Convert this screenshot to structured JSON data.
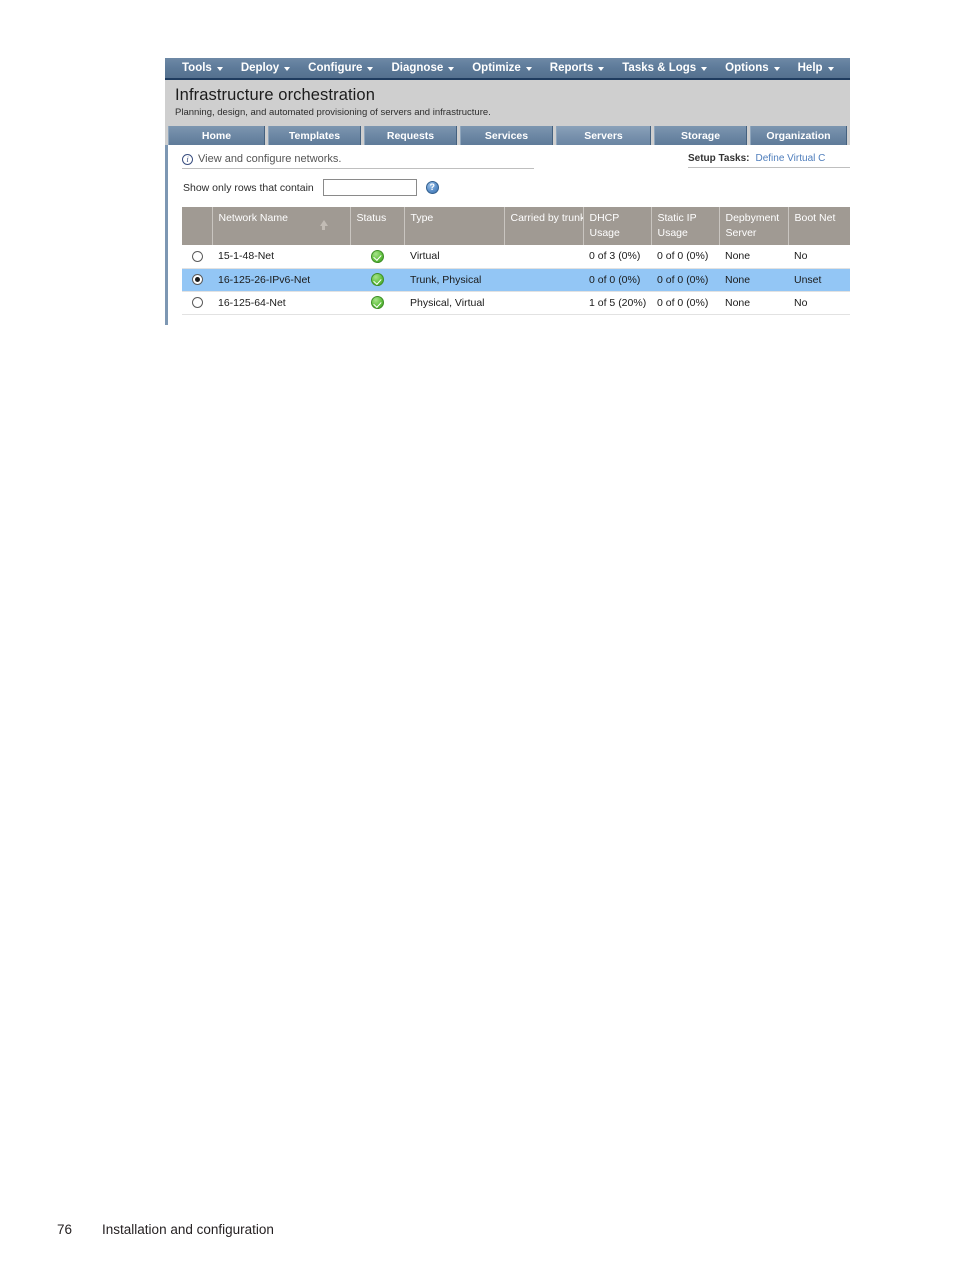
{
  "menu_bar": {
    "items": [
      {
        "label": "Tools",
        "has_caret": true
      },
      {
        "label": "Deploy",
        "has_caret": true
      },
      {
        "label": "Configure",
        "has_caret": true
      },
      {
        "label": "Diagnose",
        "has_caret": true
      },
      {
        "label": "Optimize",
        "has_caret": true
      },
      {
        "label": "Reports",
        "has_caret": true
      },
      {
        "label": "Tasks & Logs",
        "has_caret": true
      },
      {
        "label": "Options",
        "has_caret": true
      },
      {
        "label": "Help",
        "has_caret": true
      }
    ]
  },
  "header": {
    "title": "Infrastructure orchestration",
    "subtitle": "Planning, design, and automated provisioning of servers and infrastructure."
  },
  "tabs": [
    {
      "label": "Home",
      "active": false
    },
    {
      "label": "Templates",
      "active": false
    },
    {
      "label": "Requests",
      "active": false
    },
    {
      "label": "Services",
      "active": false
    },
    {
      "label": "Servers",
      "active": true
    },
    {
      "label": "Storage",
      "active": false
    },
    {
      "label": "Organization",
      "active": false
    }
  ],
  "info_bar": {
    "icon": "info-icon",
    "text": "View and configure networks."
  },
  "setup_tasks": {
    "label": "Setup Tasks:",
    "link_text": "Define Virtual C",
    "link_color": "#4f7ebc"
  },
  "filter": {
    "label": "Show only rows that contain",
    "value": "",
    "placeholder": "",
    "help_icon": "help-icon"
  },
  "table": {
    "sort_column": "Network Name",
    "sort_direction": "ascending",
    "columns": [
      {
        "key": "select",
        "label": ""
      },
      {
        "key": "name",
        "label": "Network Name"
      },
      {
        "key": "status",
        "label": "Status"
      },
      {
        "key": "type",
        "label": "Type"
      },
      {
        "key": "trunk",
        "label": "Carried by trunk"
      },
      {
        "key": "dhcp",
        "label": "DHCP",
        "sub": "Usage"
      },
      {
        "key": "static",
        "label": "Static IP",
        "sub": "Usage"
      },
      {
        "key": "deploy",
        "label": "Depbyment",
        "sub": "Server"
      },
      {
        "key": "boot",
        "label": "Boot Net"
      }
    ],
    "rows": [
      {
        "selected": false,
        "name": "15-1-48-Net",
        "status": "ok",
        "type": "Virtual",
        "trunk": "",
        "dhcp": "0 of 3 (0%)",
        "static": "0 of 0 (0%)",
        "deploy": "None",
        "boot": "No"
      },
      {
        "selected": true,
        "name": "16-125-26-IPv6-Net",
        "status": "ok",
        "type": "Trunk, Physical",
        "trunk": "",
        "dhcp": "0 of 0 (0%)",
        "static": "0 of 0 (0%)",
        "deploy": "None",
        "boot": "Unset"
      },
      {
        "selected": false,
        "name": "16-125-64-Net",
        "status": "ok",
        "type": "Physical, Virtual",
        "trunk": "",
        "dhcp": "1 of 5 (20%)",
        "static": "0 of 0 (0%)",
        "deploy": "None",
        "boot": "No"
      }
    ]
  },
  "page_footer": {
    "page_number": "76",
    "chapter": "Installation and configuration"
  },
  "colors": {
    "menu_bar": "#5d7a99",
    "title_band": "#cfcfcf",
    "tab": "#6b86a3",
    "table_header": "#a09a93",
    "row_selected": "#93c6f5",
    "status_ok": "#62c13f",
    "link": "#4f7ebc"
  }
}
